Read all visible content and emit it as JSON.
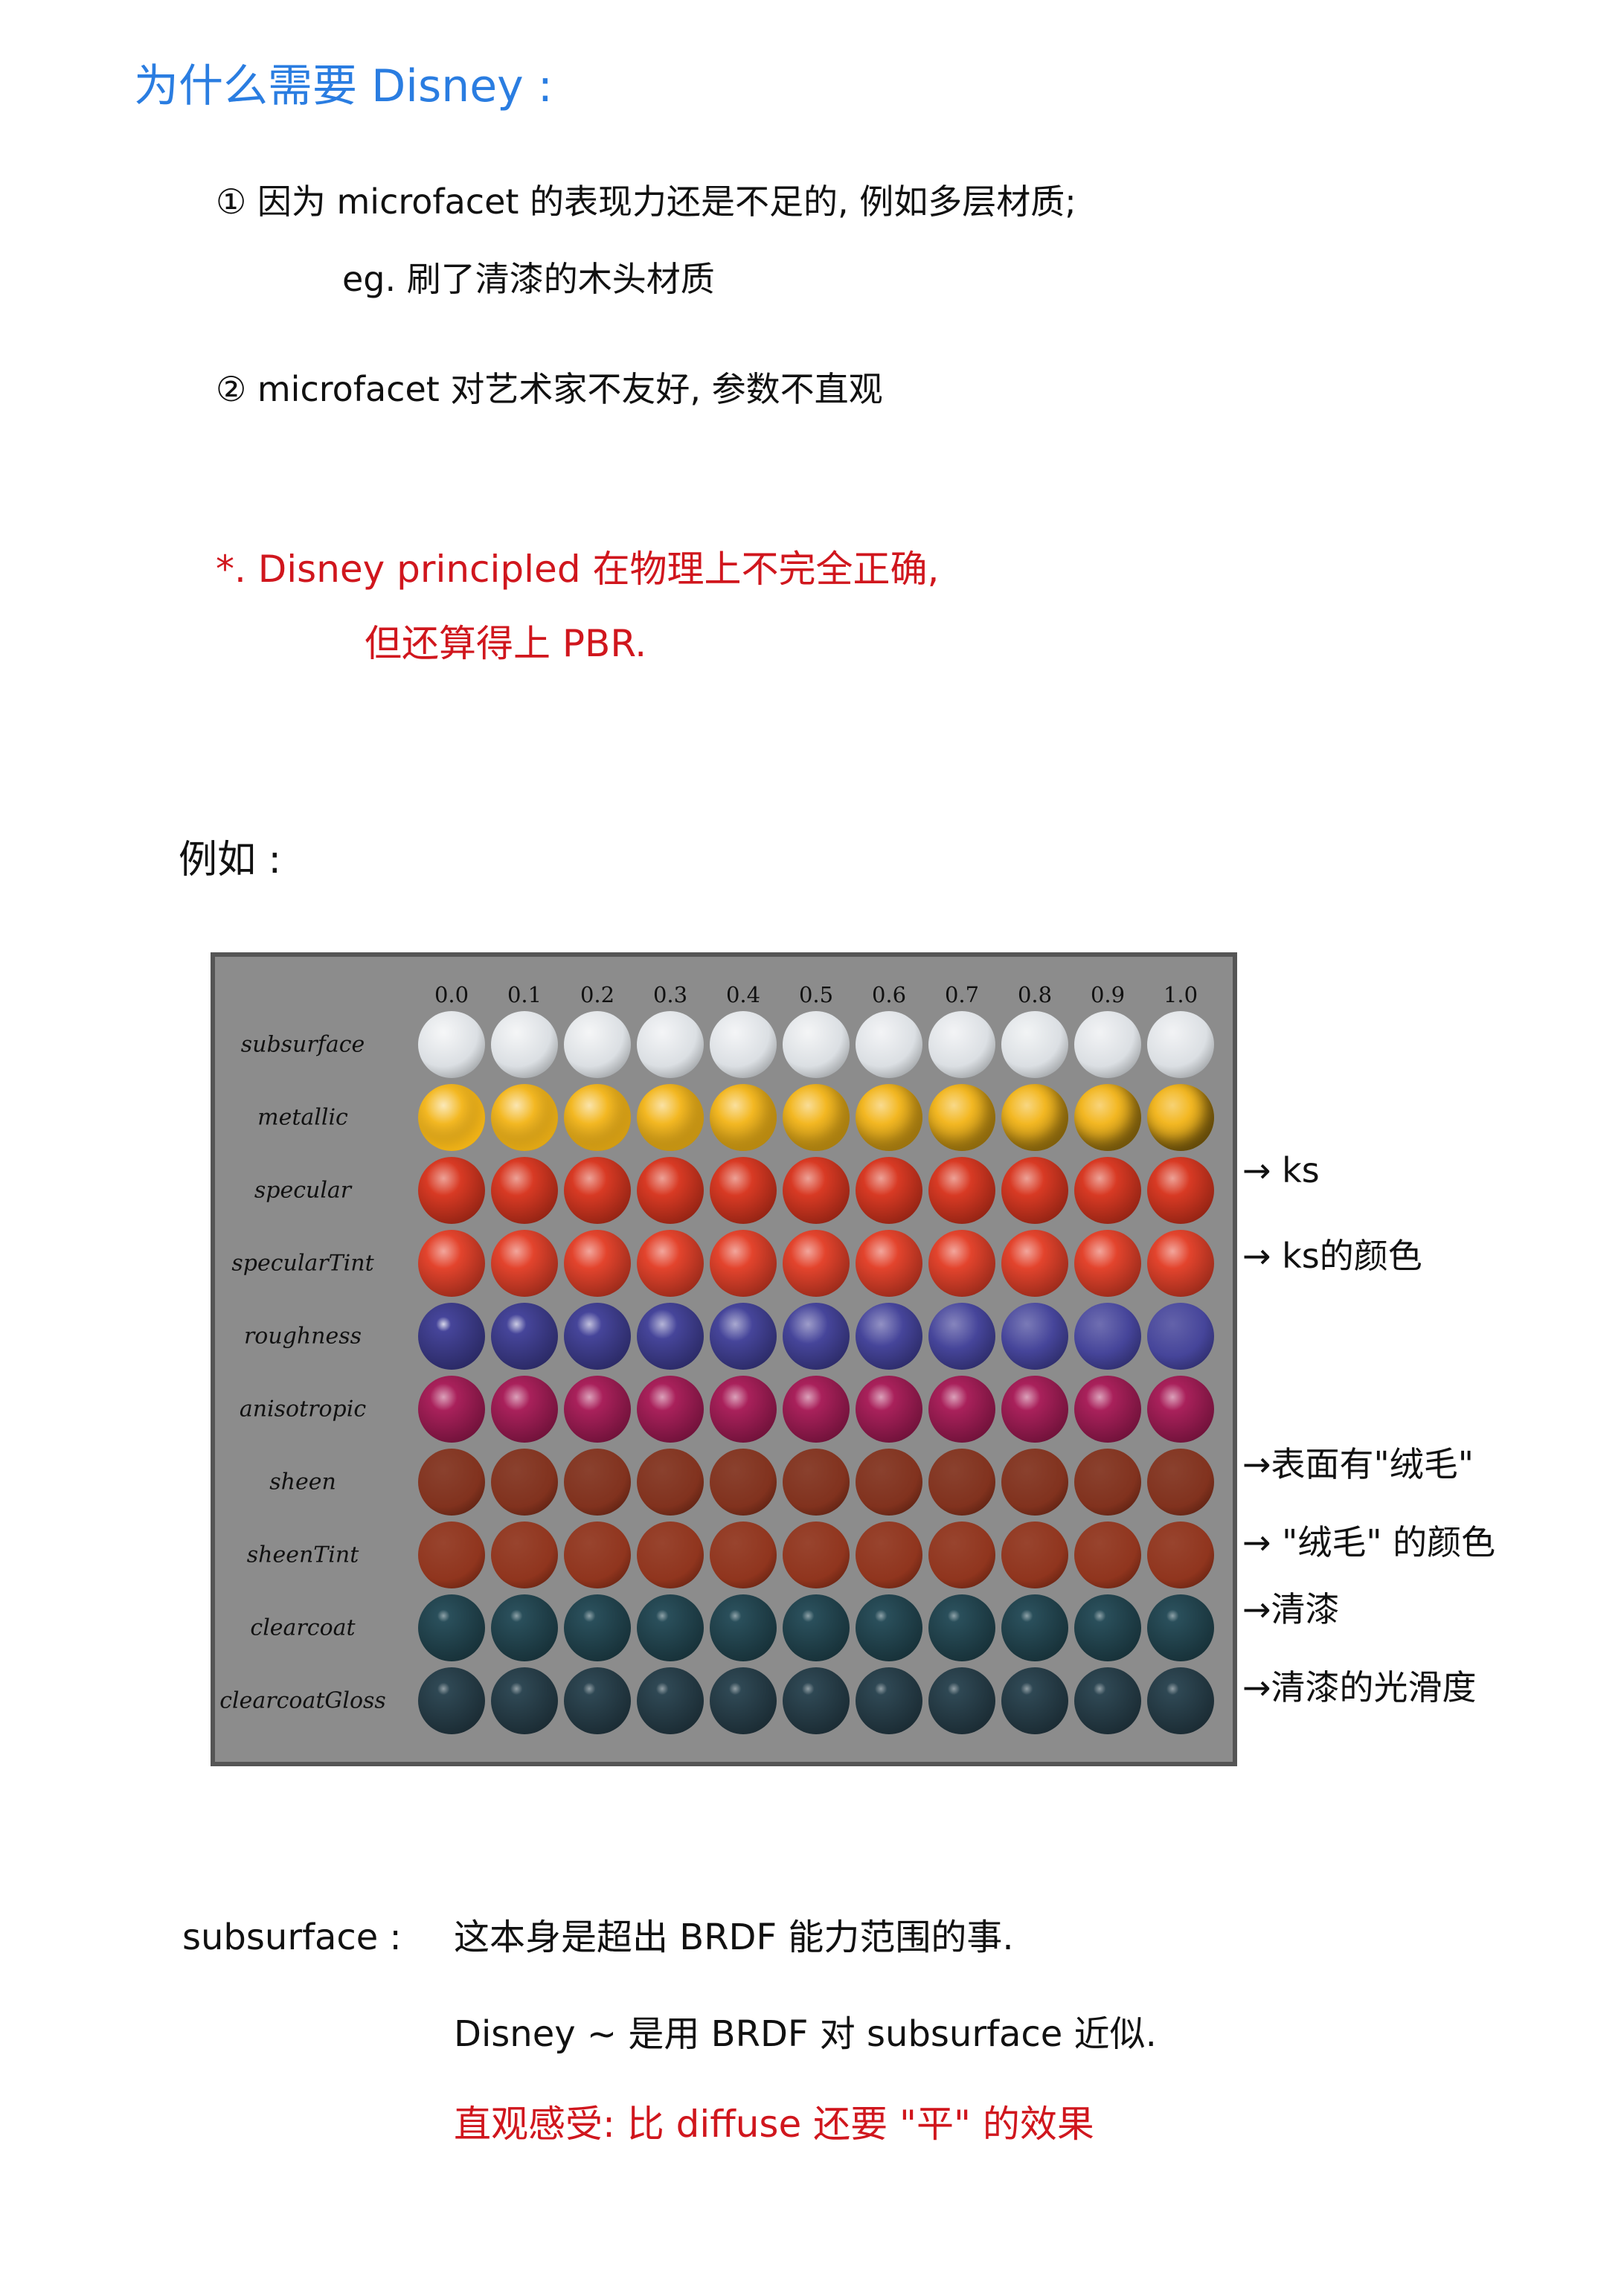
{
  "notes": {
    "heading": "为什么需要 Disney :",
    "item1_line1": "① 因为 microfacet 的表现力还是不足的, 例如多层材质;",
    "item1_line2": "eg. 刷了清漆的木头材质",
    "item2": "② microfacet 对艺术家不友好, 参数不直观",
    "star_line1": "*. Disney principled 在物理上不完全正确,",
    "star_line2": "但还算得上 PBR.",
    "example_label": "例如 :"
  },
  "figure": {
    "columns": [
      "0.0",
      "0.1",
      "0.2",
      "0.3",
      "0.4",
      "0.5",
      "0.6",
      "0.7",
      "0.8",
      "0.9",
      "1.0"
    ],
    "rows": [
      {
        "label": "subsurface",
        "color": "#d9dde2",
        "shine": "soft"
      },
      {
        "label": "metallic",
        "color": "#f2b417",
        "shine": "metal"
      },
      {
        "label": "specular",
        "color": "#d63018",
        "shine": "gloss"
      },
      {
        "label": "specularTint",
        "color": "#e23a22",
        "shine": "gloss"
      },
      {
        "label": "roughness",
        "color": "#3c3b95",
        "shine": "rough"
      },
      {
        "label": "anisotropic",
        "color": "#a41552",
        "shine": "aniso"
      },
      {
        "label": "sheen",
        "color": "#7a2712",
        "shine": "matte"
      },
      {
        "label": "sheenTint",
        "color": "#8a2a12",
        "shine": "matte"
      },
      {
        "label": "clearcoat",
        "color": "#1f4652",
        "shine": "coat"
      },
      {
        "label": "clearcoatGloss",
        "color": "#243e4b",
        "shine": "coat"
      }
    ]
  },
  "annotations": {
    "specular": "→ ks",
    "specularTint": "→ ks的颜色",
    "sheen": "→表面有\"绒毛\"",
    "sheenTint": "→ \"绒毛\" 的颜色",
    "clearcoat": "→清漆",
    "clearcoatGloss": "→清漆的光滑度"
  },
  "bottom": {
    "term": "subsurface :",
    "line1": "这本身是超出 BRDF 能力范围的事.",
    "line2": "Disney ~ 是用 BRDF 对 subsurface 近似.",
    "line3": "直观感受: 比 diffuse 还要 \"平\" 的效果"
  }
}
